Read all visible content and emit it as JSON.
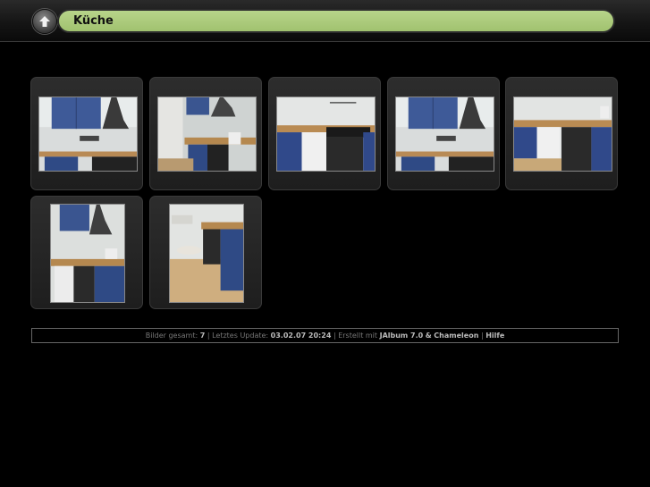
{
  "header": {
    "title": "Küche",
    "up_icon": "arrow-up-icon"
  },
  "thumbnails": [
    {
      "alt": "Küche 1",
      "orientation": "landscape",
      "scene": "cabinets-hood"
    },
    {
      "alt": "Küche 2",
      "orientation": "landscape",
      "scene": "corridor"
    },
    {
      "alt": "Küche 3",
      "orientation": "landscape",
      "scene": "stove"
    },
    {
      "alt": "Küche 4",
      "orientation": "landscape",
      "scene": "cabinets-hood"
    },
    {
      "alt": "Küche 5",
      "orientation": "landscape",
      "scene": "sink-stove"
    },
    {
      "alt": "Küche 6",
      "orientation": "portrait",
      "scene": "corner"
    },
    {
      "alt": "Küche 7",
      "orientation": "portrait",
      "scene": "floor"
    }
  ],
  "footer": {
    "count_label": "Bilder gesamt:",
    "count": "7",
    "sep": "|",
    "update_label": "Letztes Update:",
    "update": "03.02.07 20:24",
    "created_label": "Erstellt mit",
    "tool": "JAlbum 7.0",
    "amp": "&",
    "skin": "Chameleon",
    "help": "Hilfe"
  },
  "colors": {
    "title_pill": "#a9c87a",
    "background": "#000000",
    "thumb_frame": "#262626"
  }
}
